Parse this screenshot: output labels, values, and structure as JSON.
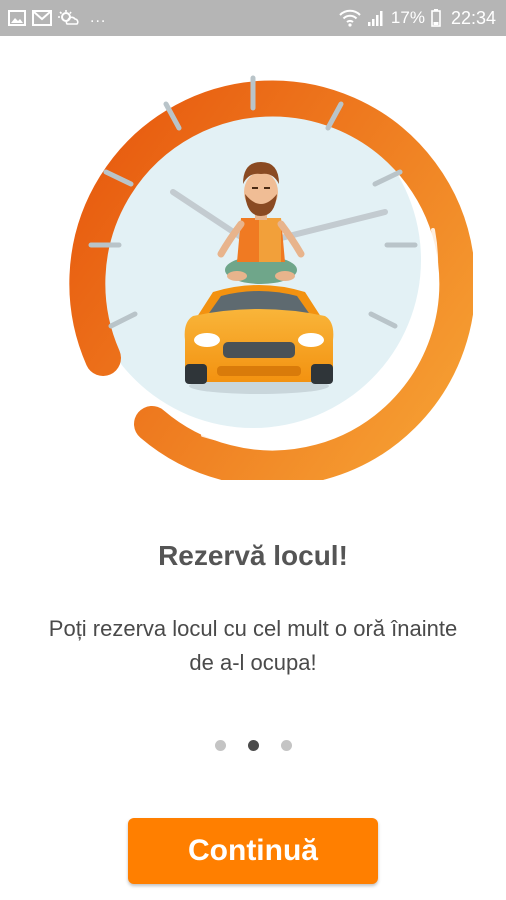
{
  "status_bar": {
    "ellipsis": "...",
    "battery_percent": "17%",
    "time": "22:34",
    "icons": [
      "image-icon",
      "mail-icon",
      "weather-icon",
      "wifi-icon",
      "signal-icon",
      "battery-icon"
    ]
  },
  "hero": {
    "illustration": "clock-with-man-meditating-on-car",
    "colors": {
      "ring_start": "#e85d10",
      "ring_end": "#f6a033",
      "clock_face": "#e3f1f5",
      "car": "#f7a21b",
      "shirt": "#f07a22"
    }
  },
  "onboarding": {
    "title": "Rezervă locul!",
    "description": "Poți rezerva locul cu cel mult o oră înainte de a-l ocupa!",
    "page_indicator": {
      "current": 2,
      "total": 3
    }
  },
  "actions": {
    "continue_label": "Continuă",
    "accent_color": "#ff7f00"
  }
}
